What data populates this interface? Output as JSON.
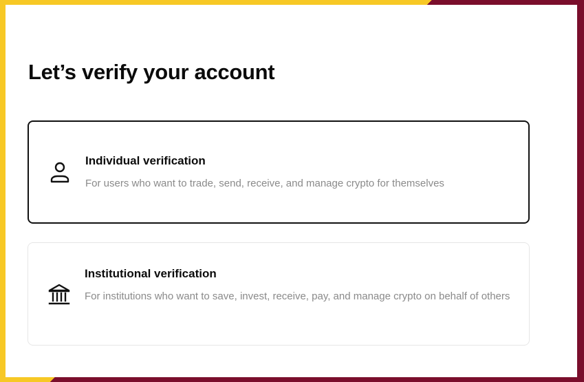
{
  "page": {
    "title": "Let’s verify your account"
  },
  "options": [
    {
      "title": "Individual verification",
      "description": "For users who want to trade, send, receive, and manage crypto for themselves",
      "icon": "person-icon",
      "selected": true
    },
    {
      "title": "Institutional verification",
      "description": "For institutions who want to save, invest, receive, pay, and manage crypto on behalf of others",
      "icon": "bank-icon",
      "selected": false
    }
  ],
  "colors": {
    "frame_yellow": "#f7c825",
    "frame_maroon": "#7a0e2c",
    "text_primary": "#0b0b0b",
    "text_secondary": "#8a8a8a",
    "selected_border": "#111111",
    "default_border": "#e6e6e6"
  }
}
